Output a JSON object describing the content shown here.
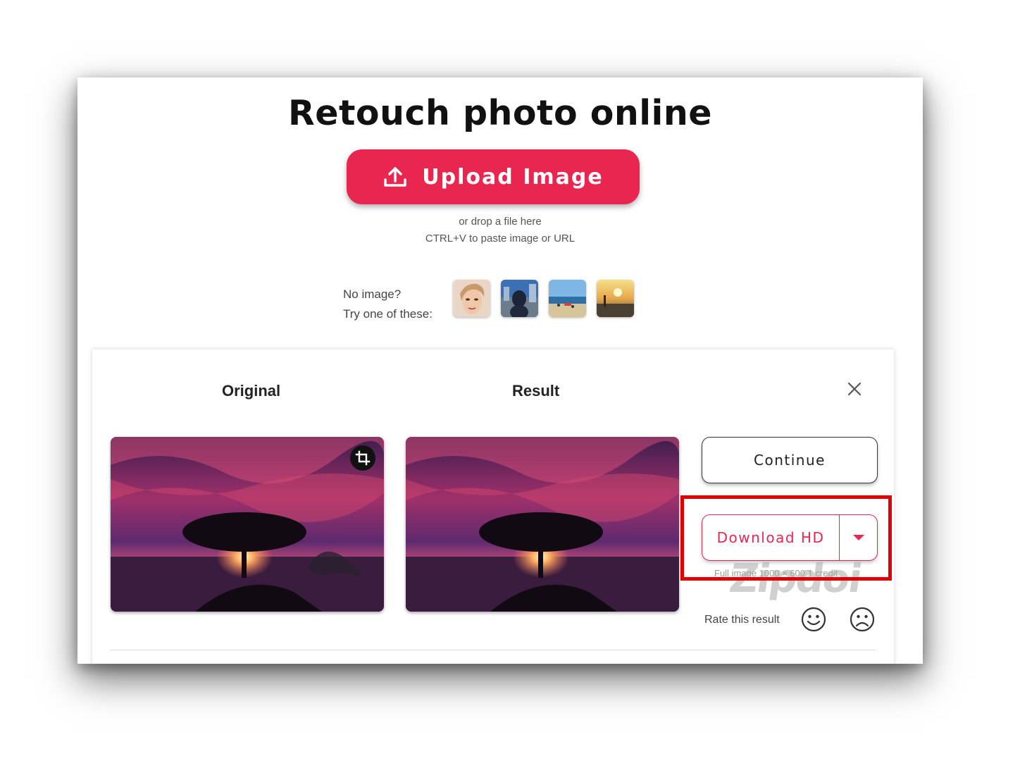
{
  "page": {
    "title": "Retouch photo online",
    "upload_button_label": "Upload Image",
    "drop_hint": "or drop a file here",
    "paste_hint": "CTRL+V to paste image or URL",
    "sample_prompt_line1": "No image?",
    "sample_prompt_line2": "Try one of these:",
    "sample_images": [
      "sample-portrait",
      "sample-city-selfie",
      "sample-beach",
      "sample-sunset"
    ]
  },
  "result_panel": {
    "original_label": "Original",
    "result_label": "Result",
    "continue_label": "Continue",
    "download_label": "Download HD",
    "full_image_note": "Full image 1000 × 600 1 credit",
    "watermark": "Zipdoi",
    "rate_label": "Rate this result"
  },
  "colors": {
    "accent": "#e8264f",
    "highlight_box": "#e00000"
  },
  "icons": [
    "upload-icon",
    "close-icon",
    "crop-icon",
    "chevron-down-icon",
    "smiley-icon",
    "frown-icon"
  ]
}
